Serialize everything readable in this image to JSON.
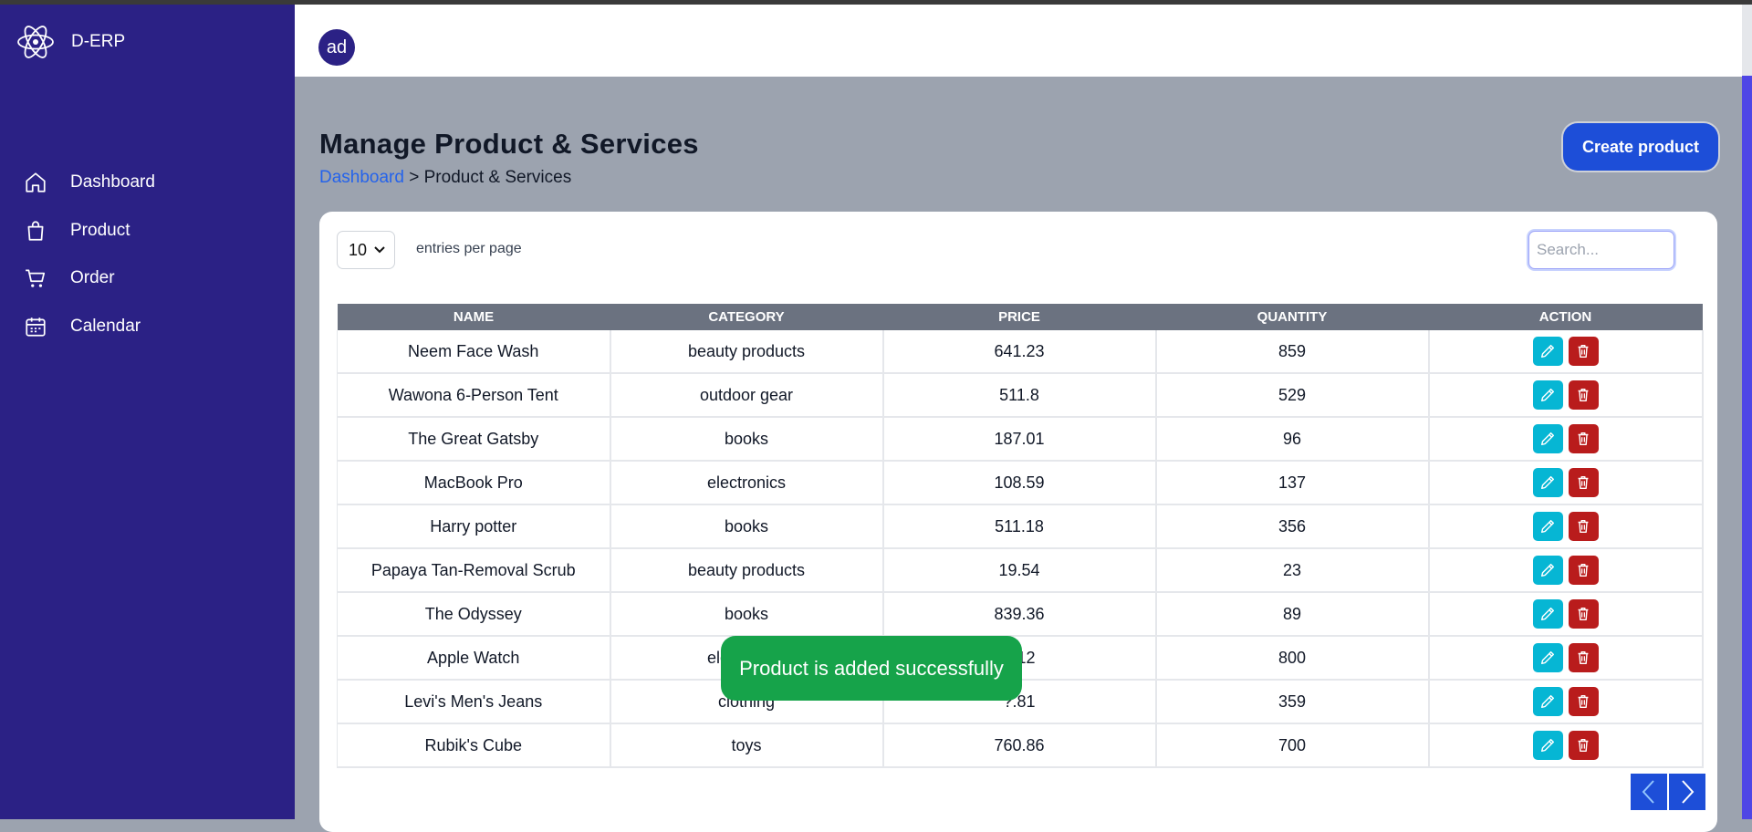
{
  "app": {
    "name": "D-ERP"
  },
  "sidebar": {
    "items": [
      {
        "label": "Dashboard",
        "icon": "home-icon"
      },
      {
        "label": "Product",
        "icon": "shopping-bag-icon"
      },
      {
        "label": "Order",
        "icon": "cart-icon"
      },
      {
        "label": "Calendar",
        "icon": "calendar-icon"
      }
    ]
  },
  "header": {
    "avatar_text": "ad"
  },
  "page": {
    "title": "Manage Product & Services",
    "breadcrumb": {
      "link": "Dashboard",
      "separator": ">",
      "current": "Product & Services"
    },
    "create_button": "Create product"
  },
  "table_controls": {
    "entries_value": "10",
    "entries_label": "entries per page",
    "search_placeholder": "Search..."
  },
  "table": {
    "columns": [
      "NAME",
      "CATEGORY",
      "PRICE",
      "QUANTITY",
      "ACTION"
    ],
    "rows": [
      {
        "name": "Neem Face Wash",
        "category": "beauty products",
        "price": "641.23",
        "quantity": "859"
      },
      {
        "name": "Wawona 6-Person Tent",
        "category": "outdoor gear",
        "price": "511.8",
        "quantity": "529"
      },
      {
        "name": "The Great Gatsby",
        "category": "books",
        "price": "187.01",
        "quantity": "96"
      },
      {
        "name": "MacBook Pro",
        "category": "electronics",
        "price": "108.59",
        "quantity": "137"
      },
      {
        "name": "Harry potter",
        "category": "books",
        "price": "511.18",
        "quantity": "356"
      },
      {
        "name": "Papaya Tan-Removal Scrub",
        "category": "beauty products",
        "price": "19.54",
        "quantity": "23"
      },
      {
        "name": "The Odyssey",
        "category": "books",
        "price": "839.36",
        "quantity": "89"
      },
      {
        "name": "Apple Watch",
        "category": "electronics",
        "price": "?.12",
        "quantity": "800"
      },
      {
        "name": "Levi's Men's Jeans",
        "category": "clothing",
        "price": "?.81",
        "quantity": "359"
      },
      {
        "name": "Rubik's Cube",
        "category": "toys",
        "price": "760.86",
        "quantity": "700"
      }
    ]
  },
  "toast": {
    "message": "Product is added successfully"
  },
  "colors": {
    "sidebar": "#2b2185",
    "primary": "#1d4ed8",
    "edit": "#06b6d4",
    "delete": "#b91c1c",
    "success": "#16a34a"
  }
}
